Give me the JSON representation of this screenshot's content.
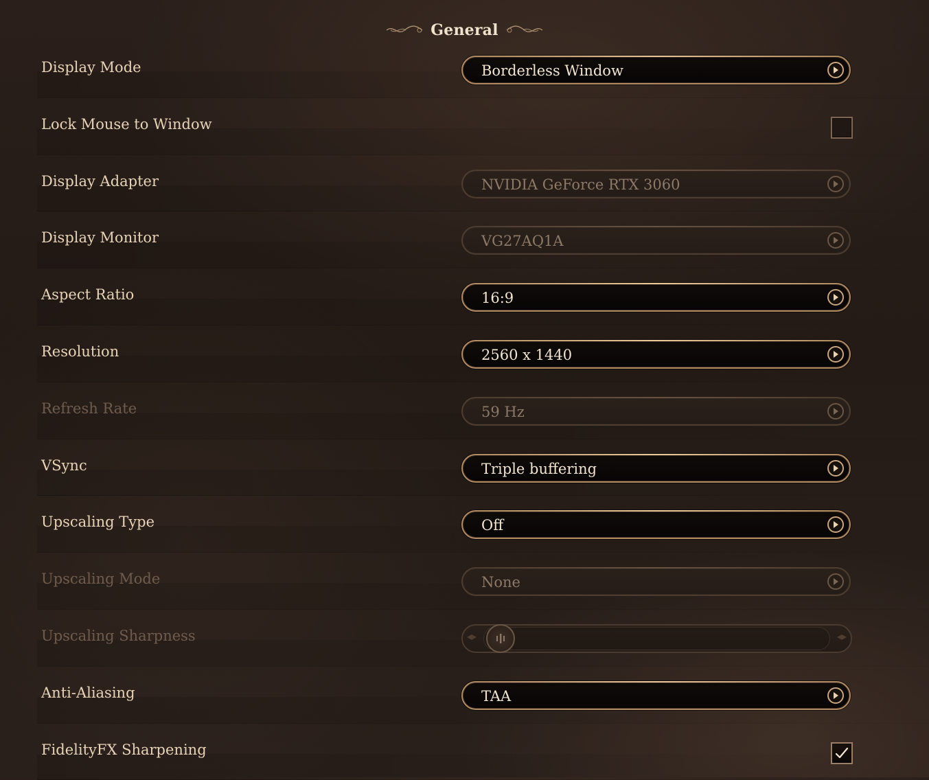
{
  "header": {
    "title": "General"
  },
  "settings": [
    {
      "label": "Display Mode",
      "control": "dropdown",
      "value": "Borderless Window",
      "enabled": true
    },
    {
      "label": "Lock Mouse to Window",
      "control": "checkbox",
      "checked": false,
      "enabled": true
    },
    {
      "label": "Display Adapter",
      "control": "dropdown",
      "value": "NVIDIA GeForce RTX 3060",
      "enabled": false
    },
    {
      "label": "Display Monitor",
      "control": "dropdown",
      "value": "VG27AQ1A",
      "enabled": false
    },
    {
      "label": "Aspect Ratio",
      "control": "dropdown",
      "value": "16:9",
      "enabled": true
    },
    {
      "label": "Resolution",
      "control": "dropdown",
      "value": "2560 x 1440",
      "enabled": true
    },
    {
      "label": "Refresh Rate",
      "control": "dropdown",
      "value": "59 Hz",
      "enabled": false
    },
    {
      "label": "VSync",
      "control": "dropdown",
      "value": "Triple buffering",
      "enabled": true
    },
    {
      "label": "Upscaling Type",
      "control": "dropdown",
      "value": "Off",
      "enabled": true
    },
    {
      "label": "Upscaling Mode",
      "control": "dropdown",
      "value": "None",
      "enabled": false
    },
    {
      "label": "Upscaling Sharpness",
      "control": "slider",
      "level": 0.0,
      "enabled": false
    },
    {
      "label": "Anti-Aliasing",
      "control": "dropdown",
      "value": "TAA",
      "enabled": true
    },
    {
      "label": "FidelityFX Sharpening",
      "control": "checkbox",
      "checked": true,
      "enabled": true
    }
  ],
  "icons": {
    "dropdown_arrow": "right-arrow-icon",
    "header_flourish": "flourish-icon",
    "checkmark": "checkmark-icon",
    "slider_handle": "slider-handle-icon"
  },
  "colors": {
    "background": "#261d17",
    "label": "#e6d3b8",
    "label_disabled": "#6e5c4e",
    "control_border": "#b08a63",
    "control_fill": "#0b0806"
  }
}
